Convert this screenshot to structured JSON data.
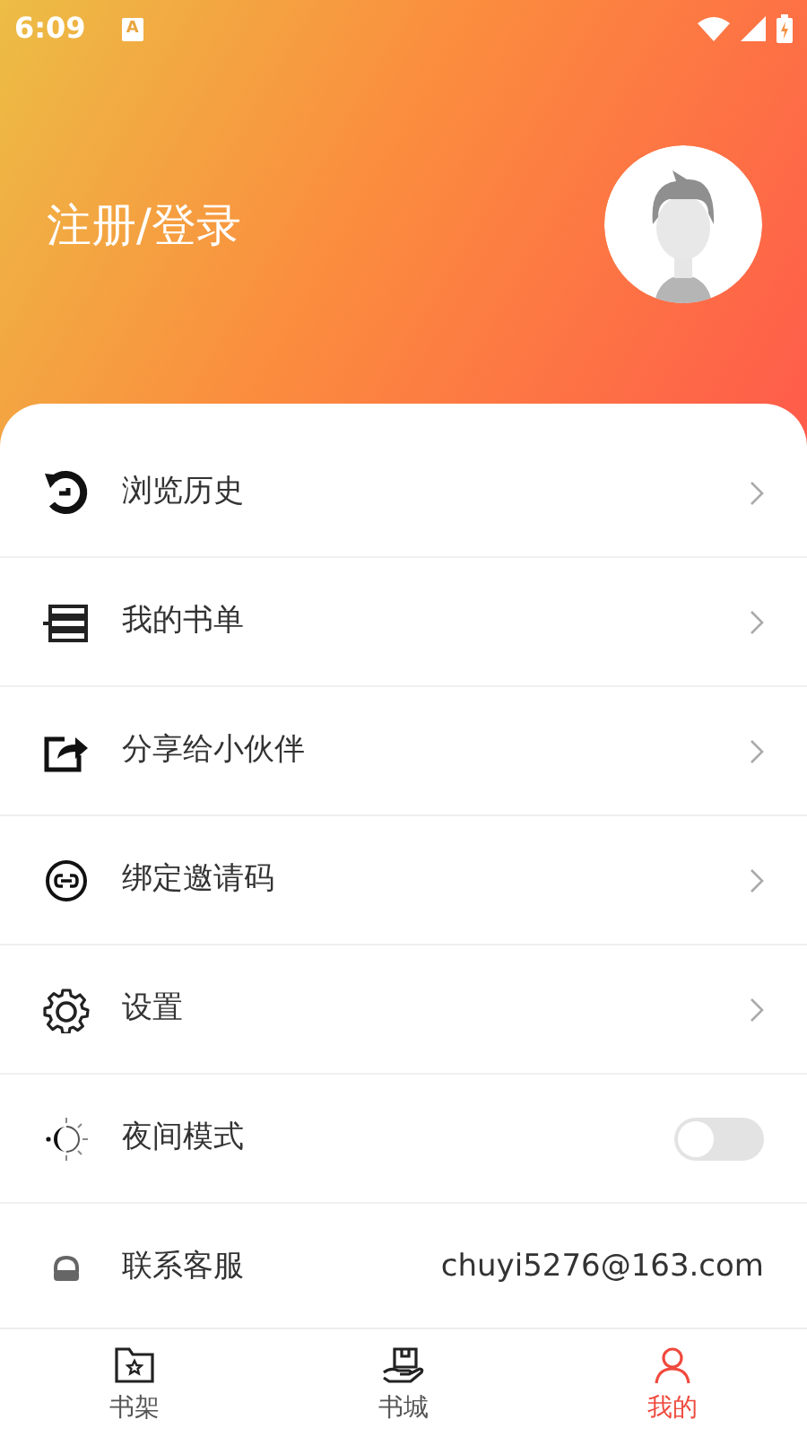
{
  "status_bar": {
    "time": "6:09",
    "notification_badge": "A"
  },
  "profile": {
    "login_label": "注册/登录"
  },
  "menu": [
    {
      "kind": "link",
      "label": "浏览历史"
    },
    {
      "kind": "link",
      "label": "我的书单"
    },
    {
      "kind": "link",
      "label": "分享给小伙伴"
    },
    {
      "kind": "link",
      "label": "绑定邀请码"
    },
    {
      "kind": "link",
      "label": "设置"
    },
    {
      "kind": "toggle",
      "label": "夜间模式",
      "on": false
    },
    {
      "kind": "info",
      "label": "联系客服",
      "value": "chuyi5276@163.com"
    }
  ],
  "tabs": [
    {
      "label": "书架",
      "selected": false
    },
    {
      "label": "书城",
      "selected": false
    },
    {
      "label": "我的",
      "selected": true
    }
  ]
}
